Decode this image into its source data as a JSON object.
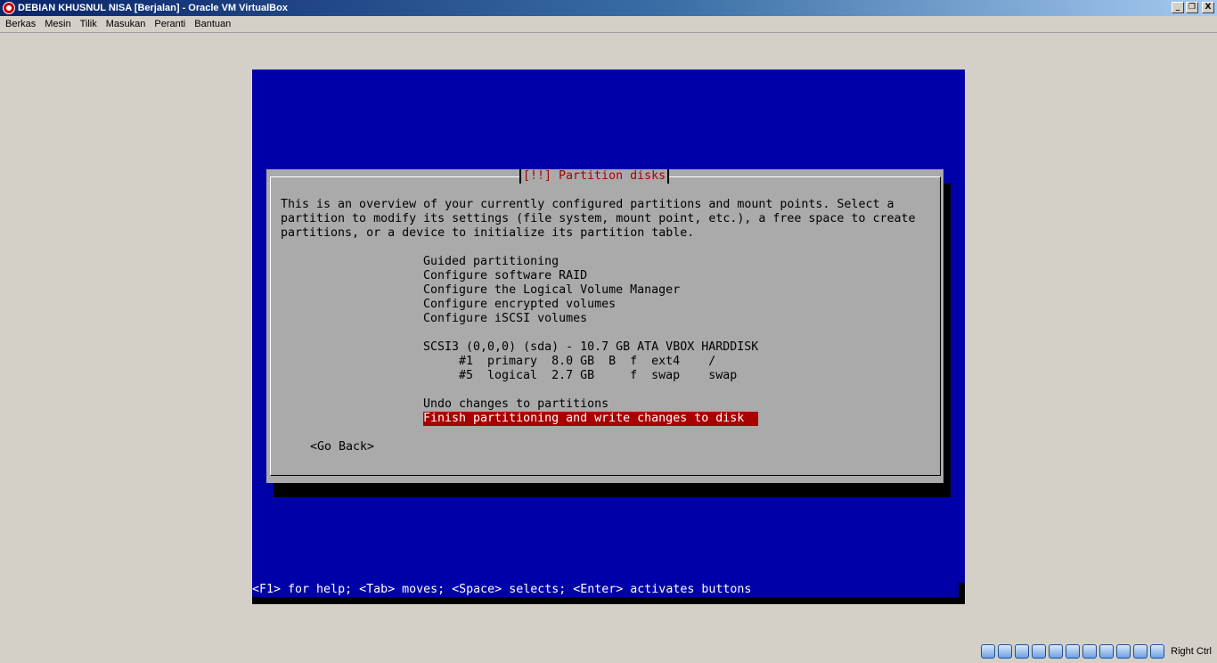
{
  "window": {
    "title": "DEBIAN KHUSNUL NISA [Berjalan] - Oracle VM VirtualBox",
    "buttons": [
      "_",
      "❐",
      "X"
    ]
  },
  "menubar": [
    "Berkas",
    "Mesin",
    "Tilik",
    "Masukan",
    "Peranti",
    "Bantuan"
  ],
  "installer": {
    "dialog_title": "[!!] Partition disks",
    "intro": [
      "This is an overview of your currently configured partitions and mount points. Select a",
      "partition to modify its settings (file system, mount point, etc.), a free space to create",
      "partitions, or a device to initialize its partition table."
    ],
    "options": [
      "Guided partitioning",
      "Configure software RAID",
      "Configure the Logical Volume Manager",
      "Configure encrypted volumes",
      "Configure iSCSI volumes"
    ],
    "disk": "SCSI3 (0,0,0) (sda) - 10.7 GB ATA VBOX HARDDISK",
    "partitions": [
      "#1  primary  8.0 GB  B  f  ext4    /",
      "#5  logical  2.7 GB     f  swap    swap"
    ],
    "undo": "Undo changes to partitions",
    "finish": "Finish partitioning and write changes to disk",
    "go_back": "<Go Back>",
    "status_line": "<F1> for help; <Tab> moves; <Space> selects; <Enter> activates buttons",
    "colors": {
      "background": "#0000a8",
      "dialog": "#aaaaaa",
      "highlight": "#a80000"
    }
  },
  "statusbar": {
    "icons": [
      "optical-drive-icon",
      "floppy-icon",
      "audio-icon",
      "network-icon",
      "usb-icon",
      "shared-folder-icon",
      "display-icon",
      "capture-icon",
      "virtualization-icon",
      "mouse-integration-icon",
      "arrow-down-icon"
    ],
    "host_key": "Right Ctrl"
  }
}
